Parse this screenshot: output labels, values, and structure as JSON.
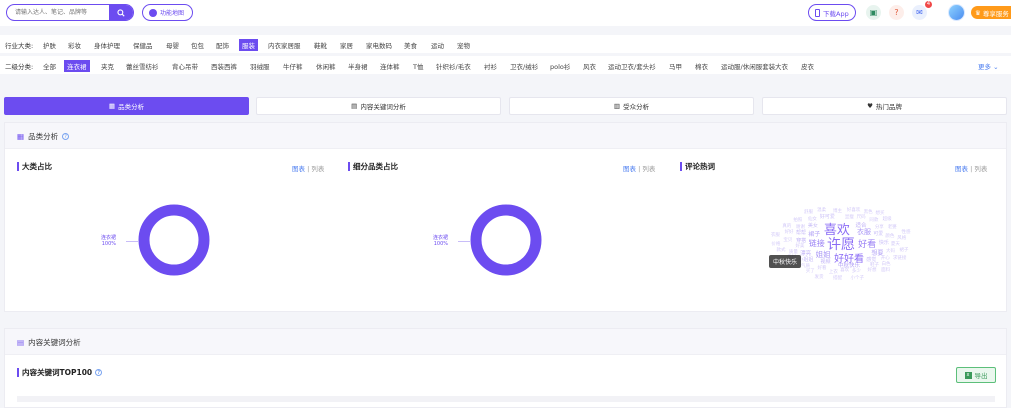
{
  "search": {
    "placeholder": "请输入达人、笔记、品牌等"
  },
  "header": {
    "map_label": "功能地图",
    "download_label": "下载App",
    "message_badge": "4",
    "buy_label": "尊享服务",
    "accent": "#6c4cf0"
  },
  "industry": {
    "label": "行业大类:",
    "items": [
      "护肤",
      "彩妆",
      "身体护理",
      "保健品",
      "母婴",
      "包包",
      "配饰",
      "服装",
      "内衣家居服",
      "鞋靴",
      "家居",
      "家电数码",
      "美食",
      "运动",
      "宠物"
    ],
    "active": "服装"
  },
  "subcat": {
    "label": "二级分类:",
    "items": [
      "全部",
      "连衣裙",
      "夹克",
      "蕾丝雪纺衫",
      "背心吊带",
      "西装西裤",
      "羽绒服",
      "牛仔裤",
      "休闲裤",
      "半身裙",
      "连体裤",
      "T恤",
      "针织衫/毛衣",
      "衬衫",
      "卫衣/绒衫",
      "polo衫",
      "风衣",
      "运动卫衣/套头衫",
      "马甲",
      "棉衣",
      "运动服/休闲服套装",
      "大衣",
      "皮衣"
    ],
    "active": "连衣裙",
    "more_label": "更多"
  },
  "tabs": [
    {
      "label": "品类分析",
      "icon": "grid-icon",
      "active": true
    },
    {
      "label": "内容关键词分析",
      "icon": "chat-icon",
      "active": false
    },
    {
      "label": "受众分析",
      "icon": "document-icon",
      "active": false
    },
    {
      "label": "热门品牌",
      "icon": "heart-icon",
      "active": false
    }
  ],
  "category_panel": {
    "title": "品类分析",
    "charts": [
      {
        "title": "大类占比",
        "toggle_chart": "图表",
        "toggle_list": "列表",
        "slice_label": "连衣裙",
        "slice_value": "100%"
      },
      {
        "title": "细分品类占比",
        "toggle_chart": "图表",
        "toggle_list": "列表",
        "slice_label": "连衣裙",
        "slice_value": "100%"
      },
      {
        "title": "评论热词",
        "toggle_chart": "图表",
        "toggle_list": "列表"
      }
    ],
    "tooltip": "中秋快乐"
  },
  "chart_data": [
    {
      "type": "pie",
      "title": "大类占比",
      "categories": [
        "连衣裙"
      ],
      "values": [
        100
      ]
    },
    {
      "type": "pie",
      "title": "细分品类占比",
      "categories": [
        "连衣裙"
      ],
      "values": [
        100
      ]
    }
  ],
  "wordcloud": [
    {
      "t": "许愿",
      "s": 14,
      "c": "#8b6cf5"
    },
    {
      "t": "喜欢",
      "s": 13,
      "c": "#8b6cf5"
    },
    {
      "t": "好好看",
      "s": 10,
      "c": "#8b6cf5"
    },
    {
      "t": "好看",
      "s": 9,
      "c": "#9a80f5"
    },
    {
      "t": "链接",
      "s": 8,
      "c": "#9a80f5"
    },
    {
      "t": "姐姐",
      "s": 7.5,
      "c": "#a996f6"
    },
    {
      "t": "衣服",
      "s": 7,
      "c": "#a996f6"
    },
    {
      "t": "裙子",
      "s": 6,
      "c": "#b4a4f6"
    },
    {
      "t": "想要",
      "s": 6,
      "c": "#b4a4f6"
    },
    {
      "t": "中秋快乐",
      "s": 5.5,
      "c": "#b4a4f6"
    },
    {
      "t": "漂亮",
      "s": 5.5,
      "c": "#c0b2f7"
    },
    {
      "t": "适合",
      "s": 5.5,
      "c": "#c0b2f7"
    },
    {
      "t": "视频",
      "s": 5,
      "c": "#c0b2f7"
    },
    {
      "t": "穿搭",
      "s": 5,
      "c": "#c0b2f7"
    },
    {
      "t": "可爱",
      "s": 5,
      "c": "#cabff8"
    },
    {
      "t": "美女",
      "s": 5,
      "c": "#cabff8"
    },
    {
      "t": "快乐",
      "s": 5,
      "c": "#cabff8"
    },
    {
      "t": "好可爱",
      "s": 5,
      "c": "#cabff8"
    },
    {
      "t": "帮帮",
      "s": 5,
      "c": "#cabff8"
    },
    {
      "t": "小姐姐",
      "s": 5,
      "c": "#cabff8"
    },
    {
      "t": "感觉",
      "s": 5,
      "c": "#cabff8"
    },
    {
      "t": "显瘦",
      "s": 4.5,
      "c": "#d3caf8"
    },
    {
      "t": "好美",
      "s": 4.5,
      "c": "#d3caf8"
    },
    {
      "t": "分享",
      "s": 4.5,
      "c": "#d3caf8"
    },
    {
      "t": "谢谢",
      "s": 4.5,
      "c": "#d3caf8"
    },
    {
      "t": "颜色",
      "s": 4.5,
      "c": "#d3caf8"
    },
    {
      "t": "质量",
      "s": 4.5,
      "c": "#d3caf8"
    },
    {
      "t": "好看",
      "s": 4.5,
      "c": "#d3caf8"
    },
    {
      "t": "宝贝",
      "s": 4.5,
      "c": "#d3caf8"
    },
    {
      "t": "尺码",
      "s": 4.5,
      "c": "#d3caf8"
    },
    {
      "t": "喜欢",
      "s": 4.5,
      "c": "#d3caf8"
    },
    {
      "t": "仙女",
      "s": 4.5,
      "c": "#d3caf8"
    },
    {
      "t": "同款",
      "s": 4.5,
      "c": "#d3caf8"
    },
    {
      "t": "大码",
      "s": 4.5,
      "c": "#d3caf8"
    },
    {
      "t": "鞋子",
      "s": 4.5,
      "c": "#d3caf8"
    },
    {
      "t": "夏天",
      "s": 4.5,
      "c": "#d3caf8"
    },
    {
      "t": "开心",
      "s": 4.5,
      "c": "#d3caf8"
    },
    {
      "t": "气质",
      "s": 4.5,
      "c": "#d3caf8"
    },
    {
      "t": "好好",
      "s": 4.5,
      "c": "#d3caf8"
    },
    {
      "t": "老婆",
      "s": 4.5,
      "c": "#d3caf8"
    },
    {
      "t": "拍照",
      "s": 4.5,
      "c": "#d3caf8"
    },
    {
      "t": "多少",
      "s": 4.5,
      "c": "#d3caf8"
    },
    {
      "t": "博主",
      "s": 4.5,
      "c": "#d3caf8"
    },
    {
      "t": "上衣",
      "s": 4.5,
      "c": "#d3caf8"
    },
    {
      "t": "身材",
      "s": 4.5,
      "c": "#d3caf8"
    },
    {
      "t": "好喜欢",
      "s": 4.5,
      "c": "#d3caf8"
    },
    {
      "t": "风格",
      "s": 4.5,
      "c": "#d3caf8"
    },
    {
      "t": "款式",
      "s": 4.5,
      "c": "#d3caf8"
    },
    {
      "t": "超级",
      "s": 4.5,
      "c": "#d3caf8"
    },
    {
      "t": "真的",
      "s": 4.5,
      "c": "#d3caf8"
    },
    {
      "t": "好想",
      "s": 4.5,
      "c": "#d3caf8"
    },
    {
      "t": "温柔",
      "s": 4.5,
      "c": "#d3caf8"
    },
    {
      "t": "白色",
      "s": 4.5,
      "c": "#d3caf8"
    },
    {
      "t": "黑色",
      "s": 4.5,
      "c": "#d3caf8"
    },
    {
      "t": "求链接",
      "s": 4.5,
      "c": "#d3caf8"
    },
    {
      "t": "买了",
      "s": 4.5,
      "c": "#d3caf8"
    },
    {
      "t": "衣服",
      "s": 4.5,
      "c": "#d3caf8"
    },
    {
      "t": "新款",
      "s": 4.5,
      "c": "#d3caf8"
    },
    {
      "t": "裙子",
      "s": 4.5,
      "c": "#d3caf8"
    },
    {
      "t": "想买",
      "s": 4.5,
      "c": "#d3caf8"
    },
    {
      "t": "价格",
      "s": 4.5,
      "c": "#d3caf8"
    },
    {
      "t": "面料",
      "s": 4.5,
      "c": "#d3caf8"
    },
    {
      "t": "舒服",
      "s": 4.5,
      "c": "#d3caf8"
    },
    {
      "t": "搭配",
      "s": 4.5,
      "c": "#d3caf8"
    },
    {
      "t": "性感",
      "s": 4.5,
      "c": "#d3caf8"
    },
    {
      "t": "小个子",
      "s": 4.5,
      "c": "#d3caf8"
    },
    {
      "t": "发货",
      "s": 4.5,
      "c": "#d3caf8"
    }
  ],
  "keyword_panel": {
    "title": "内容关键词分析",
    "sub_title": "内容关键词TOP100",
    "export_label": "导出"
  }
}
